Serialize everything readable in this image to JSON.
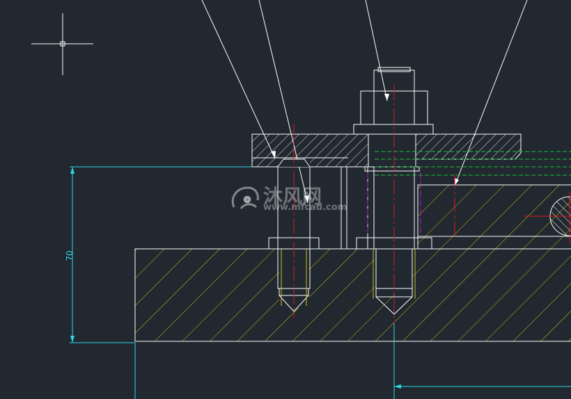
{
  "drawing": {
    "dimension_label": "70",
    "colors": {
      "background": "#212830",
      "outline": "#ffffff",
      "hatch": "#c9c21b",
      "dimension": "#2fd7e6",
      "centerline": "#e01818",
      "hidden_green": "#19c23a",
      "hidden_magenta": "#b318c9"
    }
  },
  "watermark": {
    "brand": "沐风网",
    "url": "www.mfcad.com"
  }
}
